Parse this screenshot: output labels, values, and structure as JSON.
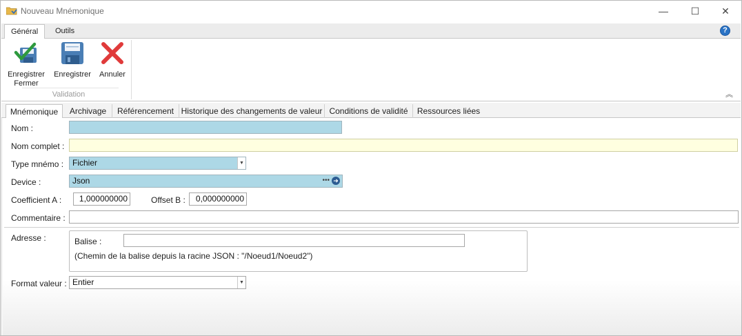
{
  "window": {
    "title": "Nouveau Mnémonique",
    "min_glyph": "—",
    "max_glyph": "☐",
    "close_glyph": "✕"
  },
  "ribbon": {
    "tabs": [
      {
        "label": "Général",
        "active": true
      },
      {
        "label": "Outils",
        "active": false
      }
    ],
    "help_glyph": "?",
    "buttons": {
      "save_close_line1": "Enregistrer",
      "save_close_line2": "Fermer",
      "save": "Enregistrer",
      "cancel": "Annuler"
    },
    "group_label": "Validation",
    "collapse_glyph": "︽"
  },
  "content_tabs": [
    "Mnémonique",
    "Archivage",
    "Référencement",
    "Historique des changements de valeur",
    "Conditions de validité",
    "Ressources liées"
  ],
  "form": {
    "nom_label": "Nom :",
    "nom_value": "",
    "nom_complet_label": "Nom complet :",
    "nom_complet_value": "",
    "type_label": "Type mnémo :",
    "type_value": "Fichier",
    "device_label": "Device :",
    "device_value": "Json",
    "coef_a_label": "Coefficient A :",
    "coef_a_value": "1,000000000",
    "offset_b_label": "Offset B :",
    "offset_b_value": "0,000000000",
    "commentaire_label": "Commentaire :",
    "commentaire_value": "",
    "adresse_label": "Adresse :",
    "balise_label": "Balise :",
    "balise_value": "",
    "balise_hint": "(Chemin de la balise depuis la racine JSON : \"/Noeud1/Noeud2\")",
    "format_label": "Format valeur :",
    "format_value": "Entier"
  },
  "colors": {
    "required_field": "#add8e6",
    "optional_field": "#ffffe0",
    "help_icon": "#2a73c5",
    "save_close_check": "#2e9a3e",
    "save_disk": "#4a7eb5",
    "cancel_x": "#e03a3a"
  }
}
